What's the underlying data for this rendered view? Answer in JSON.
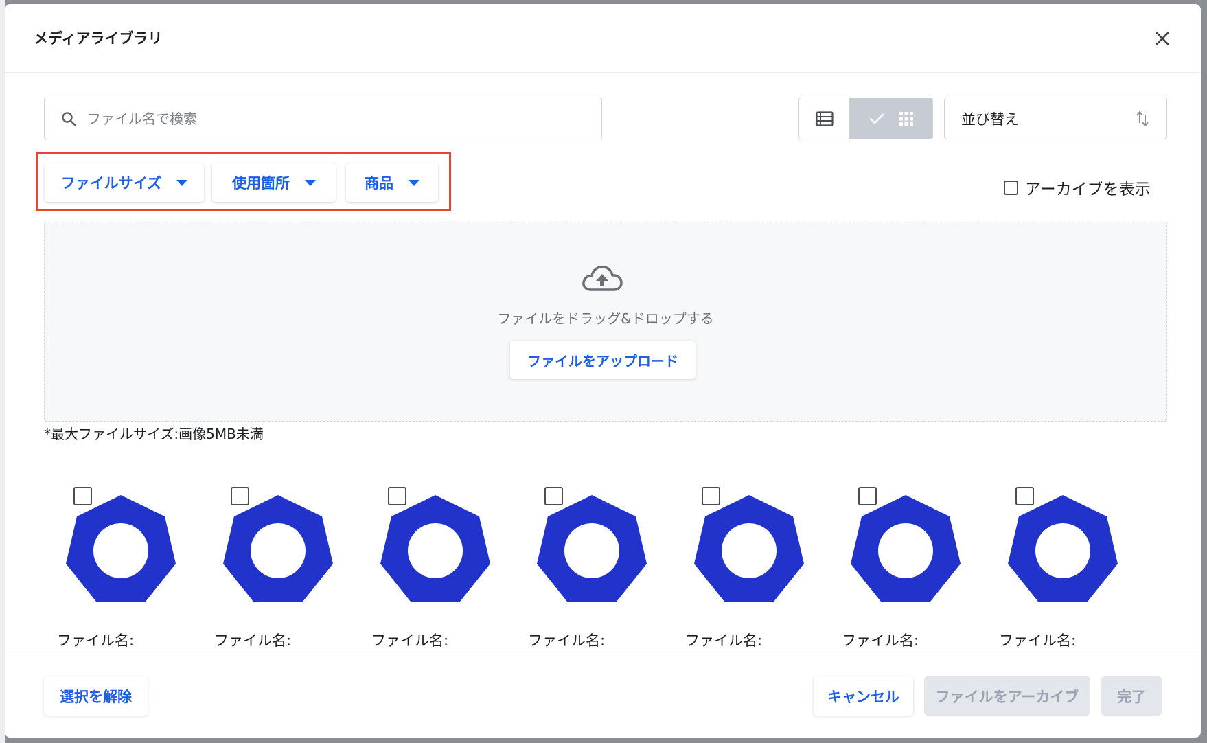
{
  "modal": {
    "title": "メディアライブラリ"
  },
  "search": {
    "placeholder": "ファイル名で検索",
    "value": ""
  },
  "view_toggle": {
    "selected": "grid"
  },
  "sort": {
    "label": "並び替え"
  },
  "filters": [
    {
      "label": "ファイルサイズ"
    },
    {
      "label": "使用箇所"
    },
    {
      "label": "商品"
    }
  ],
  "archive_toggle": {
    "label": "アーカイブを表示",
    "checked": false
  },
  "dropzone": {
    "text": "ファイルをドラッグ&ドロップする",
    "upload_label": "ファイルをアップロード"
  },
  "max_size_note": "*最大ファイルサイズ:画像5MB未満",
  "media_items": [
    {
      "name": "ファイル名:",
      "checked": false
    },
    {
      "name": "ファイル名:",
      "checked": false
    },
    {
      "name": "ファイル名:",
      "checked": false
    },
    {
      "name": "ファイル名:",
      "checked": false
    },
    {
      "name": "ファイル名:",
      "checked": false
    },
    {
      "name": "ファイル名:",
      "checked": false
    },
    {
      "name": "ファイル名:",
      "checked": false
    }
  ],
  "footer": {
    "deselect_label": "選択を解除",
    "cancel_label": "キャンセル",
    "archive_label": "ファイルをアーカイブ",
    "done_label": "完了"
  },
  "colors": {
    "accent": "#1d5ee8",
    "thumb_blue": "#2233cc",
    "highlight_red": "#e5452e",
    "disabled_bg": "#e3e6ea"
  }
}
